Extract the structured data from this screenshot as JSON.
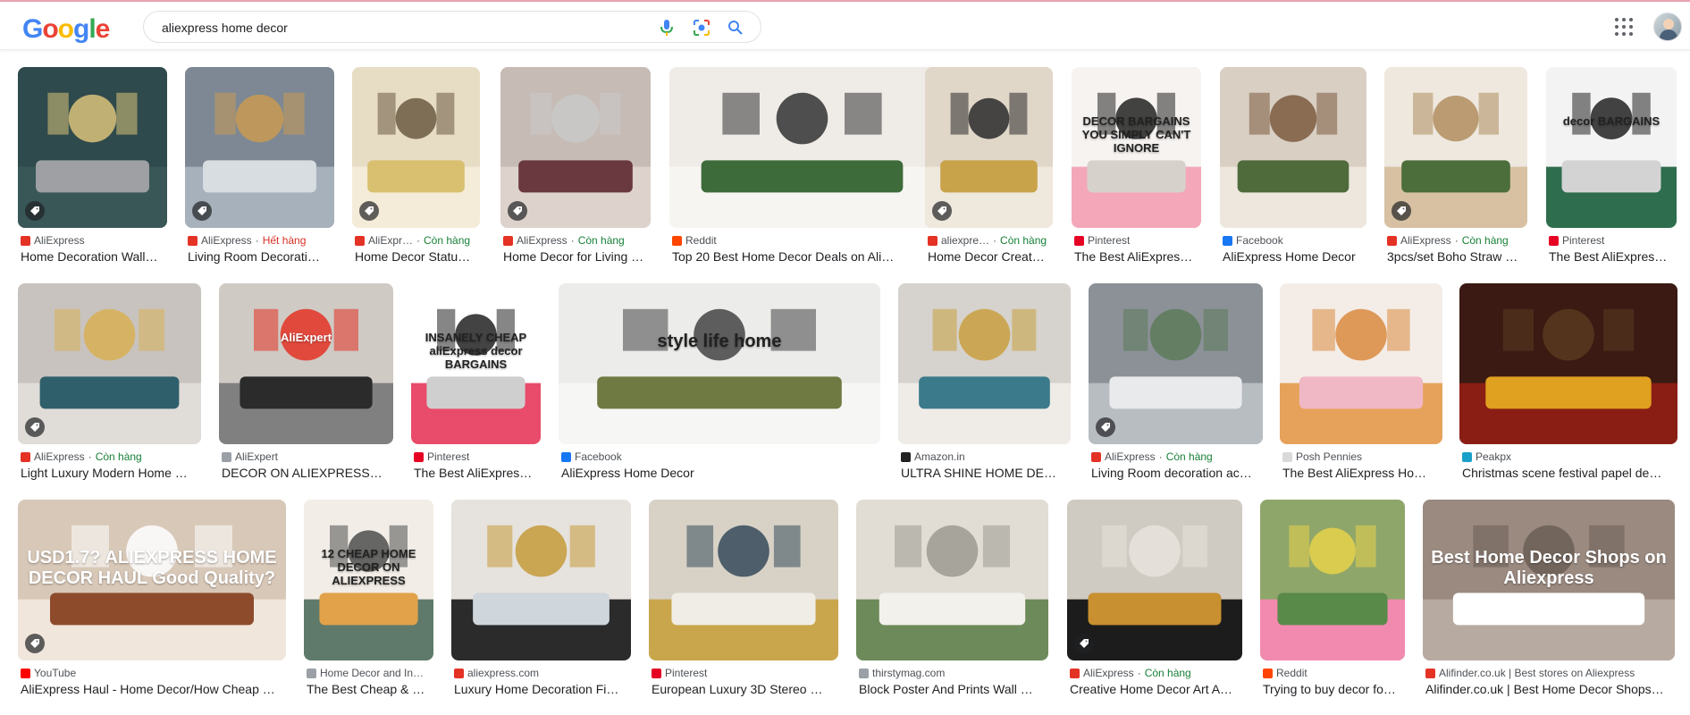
{
  "header": {
    "logo_text": "Google",
    "search": {
      "value": "aliexpress home decor"
    },
    "icons": [
      "voice-search-icon",
      "lens-icon",
      "search-icon",
      "apps-icon"
    ]
  },
  "colors": {
    "logo": [
      "#4285f4",
      "#ea4335",
      "#fbbc05",
      "#4285f4",
      "#34a853",
      "#ea4335"
    ],
    "aliexpress": "#e43225",
    "pinterest": "#e60023",
    "facebook": "#1877f2",
    "reddit": "#ff4500",
    "youtube": "#ff0000",
    "in_stock": "#188038",
    "out_of_stock": "#d93025"
  },
  "results": [
    {
      "source": "AliExpress",
      "status": "",
      "title": "Home Decoration Wall…"
    },
    {
      "source": "AliExpress",
      "status": "Hết hàng",
      "title": "Living Room Decorati…"
    },
    {
      "source": "AliExpr…",
      "status": "Còn hàng",
      "title": "Home Decor Statu…"
    },
    {
      "source": "AliExpress",
      "status": "Còn hàng",
      "title": "Home Decor for Living …"
    },
    {
      "source": "Reddit",
      "status": "",
      "title": "Top 20 Best Home Decor Deals on Ali…"
    },
    {
      "source": "aliexpre…",
      "status": "Còn hàng",
      "title": "Home Decor Creat…"
    },
    {
      "source": "Pinterest",
      "status": "",
      "title": "The Best AliExpres…",
      "overlay": "DECOR BARGAINS YOU SIMPLY CAN'T IGNORE"
    },
    {
      "source": "Facebook",
      "status": "",
      "title": "AliExpress Home Decor"
    },
    {
      "source": "AliExpress",
      "status": "Còn hàng",
      "title": "3pcs/set Boho Straw …"
    },
    {
      "source": "Pinterest",
      "status": "",
      "title": "The Best AliExpres…",
      "overlay": "decor BARGAINS"
    },
    {
      "source": "AliExpress",
      "status": "Còn hàng",
      "title": "Light Luxury Modern Home …"
    },
    {
      "source": "AliExpert",
      "status": "",
      "title": "DECOR ON ALIEXPRESS…",
      "overlay": "AliExpert"
    },
    {
      "source": "Pinterest",
      "status": "",
      "title": "The Best AliExpres…",
      "overlay": "INSANELY CHEAP aliExpress decor BARGAINS"
    },
    {
      "source": "Facebook",
      "status": "",
      "title": "AliExpress Home Decor",
      "overlay": "style life home"
    },
    {
      "source": "Amazon.in",
      "status": "",
      "title": "ULTRA SHINE HOME DE…"
    },
    {
      "source": "AliExpress",
      "status": "Còn hàng",
      "title": "Living Room decoration ac…"
    },
    {
      "source": "Posh Pennies",
      "status": "",
      "title": "The Best AliExpress Ho…"
    },
    {
      "source": "Peakpx",
      "status": "",
      "title": "Christmas scene festival papel de…"
    },
    {
      "source": "YouTube",
      "status": "",
      "title": "AliExpress Haul - Home Decor/How Cheap …",
      "overlay": "USD1.7? ALIEXPRESS HOME DECOR HAUL Good Quality?"
    },
    {
      "source": "Home Decor and In…",
      "status": "",
      "title": "The Best Cheap & …",
      "overlay": "12 CHEAP HOME DECOR ON ALIEXPRESS"
    },
    {
      "source": "aliexpress.com",
      "status": "",
      "title": "Luxury Home Decoration Fi…"
    },
    {
      "source": "Pinterest",
      "status": "",
      "title": "European Luxury 3D Stereo …"
    },
    {
      "source": "thirstymag.com",
      "status": "",
      "title": "Block Poster And Prints Wall …"
    },
    {
      "source": "AliExpress",
      "status": "Còn hàng",
      "title": "Creative Home Decor Art A…"
    },
    {
      "source": "Reddit",
      "status": "",
      "title": "Trying to buy decor fo…"
    },
    {
      "source": "Alifinder.co.uk | Best stores on Aliexpress",
      "status": "",
      "title": "Alifinder.co.uk | Best Home Decor Shops…",
      "overlay": "Best Home Decor Shops on Aliexpress"
    }
  ]
}
